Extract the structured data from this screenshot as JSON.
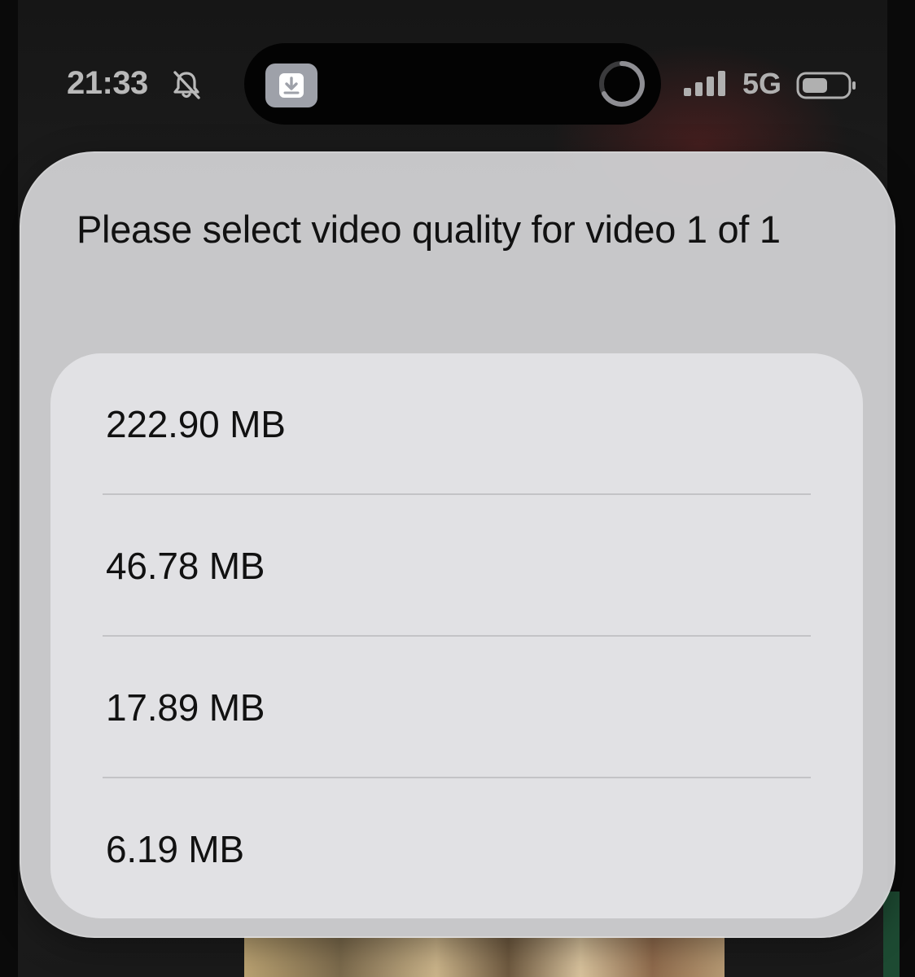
{
  "status_bar": {
    "time": "21:33",
    "network": "5G",
    "icons": [
      "bell-slash-icon",
      "signal-bars-icon",
      "battery-icon"
    ]
  },
  "dynamic_island": {
    "app_icon": "download-icon",
    "indicator": "progress-ring-icon"
  },
  "dialog": {
    "title": "Please select video quality for video 1 of 1",
    "options": [
      {
        "label": "222.90 MB"
      },
      {
        "label": "46.78 MB"
      },
      {
        "label": "17.89 MB"
      },
      {
        "label": "6.19 MB"
      }
    ]
  },
  "colors": {
    "dialog_bg": "#d4d4d6",
    "card_bg": "#e2e2e4",
    "text": "#111111",
    "status_text": "#b9b9b9"
  }
}
